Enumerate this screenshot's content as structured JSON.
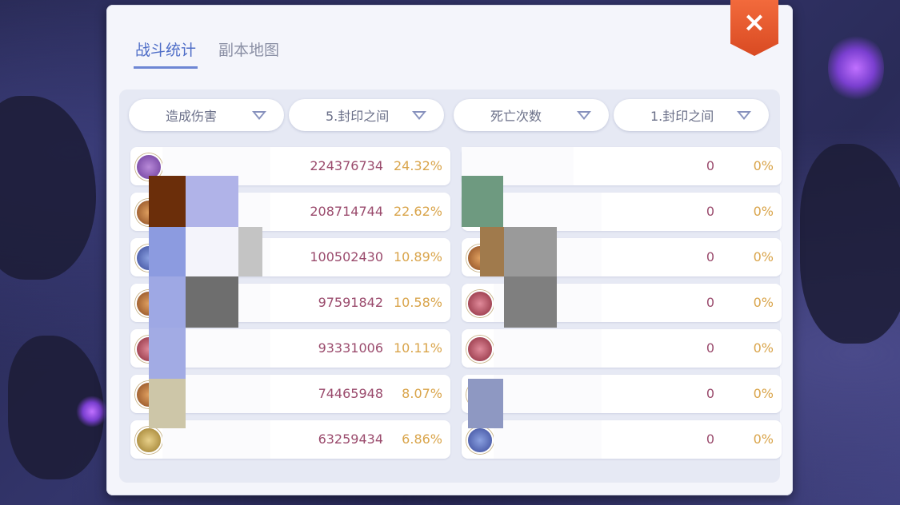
{
  "tabs": [
    {
      "label": "战斗统计",
      "active": true
    },
    {
      "label": "副本地图",
      "active": false
    }
  ],
  "close_icon": "×",
  "dropdowns": [
    {
      "label": "造成伤害"
    },
    {
      "label": "5.封印之间"
    },
    {
      "label": "死亡次数"
    },
    {
      "label": "1.封印之间"
    }
  ],
  "left_rows": [
    {
      "value": "224376734",
      "percent": "24.32%"
    },
    {
      "value": "208714744",
      "percent": "22.62%"
    },
    {
      "value": "100502430",
      "percent": "10.89%"
    },
    {
      "value": "97591842",
      "percent": "10.58%"
    },
    {
      "value": "93331006",
      "percent": "10.11%"
    },
    {
      "value": "74465948",
      "percent": "8.07%"
    },
    {
      "value": "63259434",
      "percent": "6.86%"
    }
  ],
  "right_rows": [
    {
      "value": "0",
      "percent": "0%"
    },
    {
      "value": "0",
      "percent": "0%"
    },
    {
      "value": "0",
      "percent": "0%"
    },
    {
      "value": "0",
      "percent": "0%"
    },
    {
      "value": "0",
      "percent": "0%"
    },
    {
      "value": "0",
      "percent": "0%"
    },
    {
      "value": "0",
      "percent": "0%"
    }
  ],
  "colors": {
    "accent": "#4e6dc7",
    "value": "#9a4a6c",
    "percent": "#d9a44a",
    "close": "#e55a2f"
  }
}
